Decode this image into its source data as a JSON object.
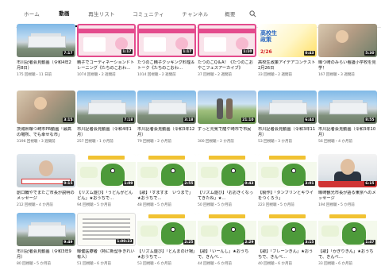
{
  "tabs": [
    {
      "label": "ホーム",
      "active": false
    },
    {
      "label": "動画",
      "active": true
    },
    {
      "label": "再生リスト",
      "active": false
    },
    {
      "label": "コミュニティ",
      "active": false
    },
    {
      "label": "チャンネル",
      "active": false
    },
    {
      "label": "概要",
      "active": false
    }
  ],
  "search_icon": "search-icon",
  "videos": [
    {
      "title": "市川記者会見動画（令和4年2月8日）",
      "meta": "175 回視聴・11 日前",
      "duration": "7:17",
      "thumb": "building"
    },
    {
      "title": "精子でコーディネーションドトレーニング《たちのこおわ…",
      "meta": "1074 回視聴・2 週間前",
      "duration": "1:17",
      "thumb": "pink"
    },
    {
      "title": "たつのこ精子クッキング料理＆トーク《たちのこおわ…",
      "meta": "1014 回視聴・2 週間前",
      "duration": "1:17",
      "thumb": "pink"
    },
    {
      "title": "たつのこQ＆A！《たつのこおやこフェスアーカイブ》",
      "meta": "37 回視聴・2 週間前",
      "duration": "1:10",
      "thumb": "pink"
    },
    {
      "title": "高校生政策アイデアコンテスト　2月26日",
      "meta": "33 回視聴・2 週間前",
      "duration": "0:43",
      "thumb": "contest"
    },
    {
      "title": "曝つ崎のみらい看護小学校を見学！",
      "meta": "167 回視聴・3 週間前",
      "duration": "5:30",
      "thumb": "photo"
    },
    {
      "title": "茨城県曝つ崎市PR動画「最高の場所、でも幸せな市」",
      "meta": "3196 回視聴・3 週間前",
      "duration": "3:15",
      "thumb": "photo"
    },
    {
      "title": "市川記者会見動画（令和4年1月）",
      "meta": "257 回視聴・1 か月前",
      "duration": "7:18",
      "thumb": "building"
    },
    {
      "title": "市川記者会見動画（令和3年12月）",
      "meta": "79 回視聴・2 か月前",
      "duration": "3:18",
      "thumb": "building"
    },
    {
      "title": "ずっと元気で龍ケ崎市で市民",
      "meta": "300 回視聴・2 か月前",
      "duration": "21:10",
      "thumb": "park"
    },
    {
      "title": "市川記者会見動画（令和3年11月）",
      "meta": "53 回視聴・3 か月前",
      "duration": "6:44",
      "thumb": "building"
    },
    {
      "title": "市川記者会見動画（令和3年10月）",
      "meta": "56 回視聴・4 か月前",
      "duration": "8:55",
      "thumb": "building"
    },
    {
      "title": "創口輪やでまたご市長が説明のメッセージ",
      "meta": "212 回視聴・4 か月前",
      "duration": "0:15",
      "thumb": "gray"
    },
    {
      "title": "【リズム遊び】「うどんがどんどん」★おうちで…",
      "meta": "94 回視聴・5 か月前",
      "duration": "1:09",
      "thumb": "green"
    },
    {
      "title": "【歌】「すますま　いつまで」★おうちで…",
      "meta": "48 回視聴・5 か月前",
      "duration": "2:55",
      "thumb": "green"
    },
    {
      "title": "【リズム遊び】「おおきくなってきたね」★…",
      "meta": "50 回視聴・5 か月前",
      "duration": "0:43",
      "thumb": "green"
    },
    {
      "title": "【製作】「タンブリンとキウイをつくろう」",
      "meta": "223 回視聴・5 か月前",
      "duration": "3:01",
      "thumb": "green"
    },
    {
      "title": "曝崎観光市長が語る東京へのメッセージ",
      "meta": "194 回視聴・5 か月前",
      "duration": "6:15",
      "thumb": "news"
    },
    {
      "title": "市川記者会見動画（令和3年9月）",
      "meta": "80 回視聴・5 か月前",
      "duration": "9:49",
      "thumb": "building"
    },
    {
      "title": "曝健医療者（特に新型手きれい有人）",
      "meta": "51 回視聴・6 か月前",
      "duration": "1:00:33",
      "thumb": "doc"
    },
    {
      "title": "【リズム遊び】「とんまのけ場」★おうちで…",
      "meta": "53 回視聴・6 か月前",
      "duration": "2:25",
      "thumb": "green"
    },
    {
      "title": "【歌】「いーんし」★おうちで、きんべ…",
      "meta": "44 回視聴・6 か月前",
      "duration": "2:29",
      "thumb": "green"
    },
    {
      "title": "【歌】「フレーンきん」★おうちで、きんべ…",
      "meta": "40 回視聴・6 か月前",
      "duration": "3:15",
      "thumb": "green"
    },
    {
      "title": "【歌】「かぎりきん」★おうちで、きんべ…",
      "meta": "33 回視聴・6 か月前",
      "duration": "1:47",
      "thumb": "green"
    }
  ]
}
